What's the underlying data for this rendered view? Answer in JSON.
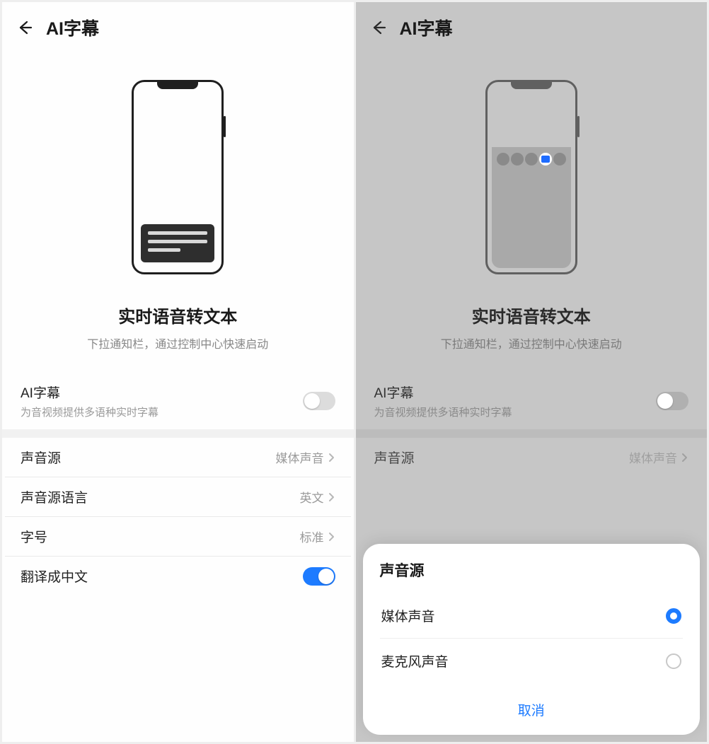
{
  "left": {
    "title": "AI字幕",
    "heroTitle": "实时语音转文本",
    "heroSubtitle": "下拉通知栏，通过控制中心快速启动",
    "toggleRow": {
      "label": "AI字幕",
      "sub": "为音视频提供多语种实时字幕",
      "on": false
    },
    "rows": [
      {
        "label": "声音源",
        "value": "媒体声音"
      },
      {
        "label": "声音源语言",
        "value": "英文"
      },
      {
        "label": "字号",
        "value": "标准"
      }
    ],
    "translateRow": {
      "label": "翻译成中文",
      "on": true
    }
  },
  "right": {
    "title": "AI字幕",
    "heroTitle": "实时语音转文本",
    "heroSubtitle": "下拉通知栏，通过控制中心快速启动",
    "toggleRow": {
      "label": "AI字幕",
      "sub": "为音视频提供多语种实时字幕",
      "on": false
    },
    "peekRow": {
      "label": "声音源",
      "value": "媒体声音"
    },
    "sheet": {
      "title": "声音源",
      "options": [
        {
          "label": "媒体声音",
          "selected": true
        },
        {
          "label": "麦克风声音",
          "selected": false
        }
      ],
      "cancel": "取消"
    }
  }
}
